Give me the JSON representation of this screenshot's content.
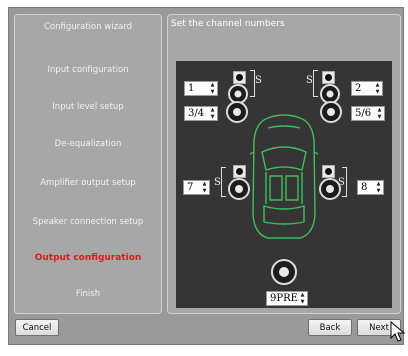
{
  "sidebar": {
    "items": [
      {
        "label": "Configuration wizard",
        "active": false
      },
      {
        "label": "Input configuration",
        "active": false
      },
      {
        "label": "Input level setup",
        "active": false
      },
      {
        "label": "De-equalization",
        "active": false
      },
      {
        "label": "Amplifier output setup",
        "active": false
      },
      {
        "label": "Speaker connection setup",
        "active": false
      },
      {
        "label": "Output configuration",
        "active": true
      },
      {
        "label": "Finish",
        "active": false
      }
    ]
  },
  "main": {
    "title": "Set the channel numbers",
    "channels": {
      "front_left_tweeter": "1",
      "front_left_woofer": "3/4",
      "front_right_tweeter": "2",
      "front_right_woofer": "5/6",
      "rear_left": "7",
      "rear_right": "8",
      "sub": "9PRE"
    },
    "link_symbol": "S"
  },
  "footer": {
    "cancel": "Cancel",
    "back": "Back",
    "next": "Next"
  },
  "colors": {
    "active_item": "#e01818",
    "car_outline": "#3fbf5a",
    "panel_bg": "#353535"
  }
}
